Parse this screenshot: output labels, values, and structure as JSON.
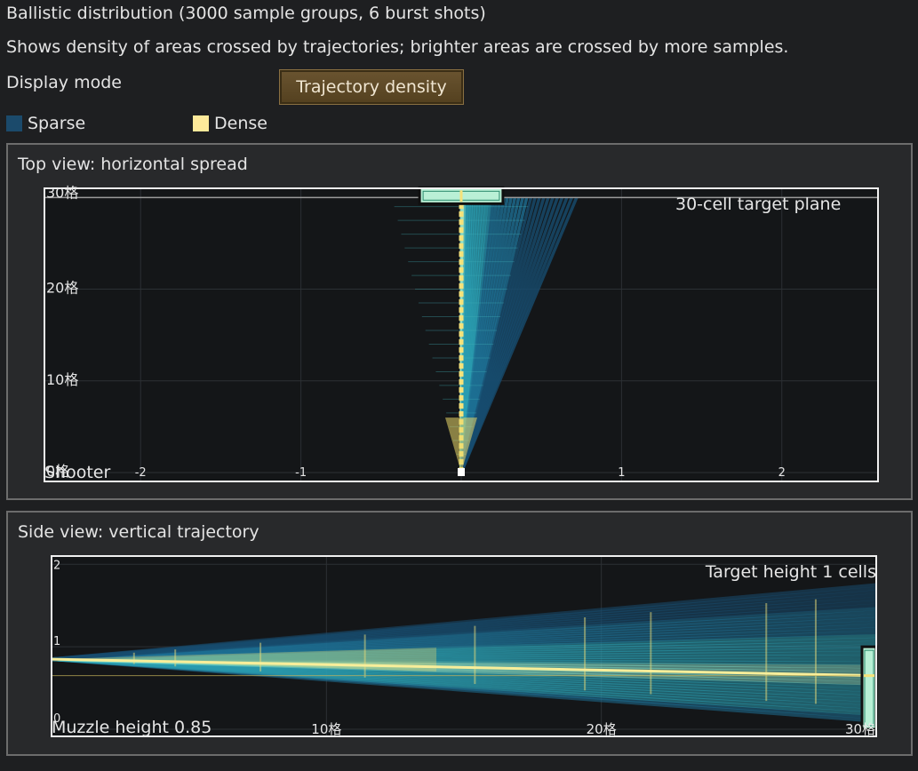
{
  "header": {
    "title": "Ballistic distribution (3000 sample groups, 6 burst shots)",
    "subtitle": "Shows density of areas crossed by trajectories; brighter areas are crossed by more samples.",
    "mode_label": "Display mode",
    "mode_button": "Trajectory density"
  },
  "legend": {
    "sparse_label": "Sparse",
    "dense_label": "Dense",
    "sparse_color": "#1b4a6b",
    "dense_color": "#fde99a"
  },
  "top_view": {
    "title": "Top view: horizontal spread",
    "shooter_label": "Shooter",
    "target_label": "30-cell target plane",
    "x_ticks": [
      "-2",
      "-1",
      "1",
      "2"
    ],
    "y_ticks": [
      "0格",
      "10格",
      "20格",
      "30格"
    ]
  },
  "side_view": {
    "title": "Side view: vertical trajectory",
    "muzzle_label": "Muzzle height 0.85",
    "target_label": "Target height 1 cells",
    "x_ticks": [
      "10格",
      "20格",
      "30格"
    ],
    "y_ticks": [
      "0",
      "1",
      "2"
    ]
  },
  "chart_data": [
    {
      "type": "heatmap",
      "title": "Top view: horizontal spread",
      "x_ticks": [
        -2,
        -1,
        1,
        2
      ],
      "y_ticks": [
        0,
        10,
        20,
        30
      ],
      "xlim": [
        -2.6,
        2.6
      ],
      "ylim": [
        0,
        31
      ],
      "spread_half_width_at_30": 0.72,
      "target": {
        "distance": 30,
        "x_range": [
          -0.26,
          0.26
        ]
      },
      "grid": true
    },
    {
      "type": "heatmap",
      "title": "Side view: vertical trajectory",
      "x_ticks": [
        10,
        20,
        30
      ],
      "y_ticks": [
        0,
        1,
        2
      ],
      "xlim": [
        0,
        30
      ],
      "ylim": [
        0,
        2.1
      ],
      "muzzle_height": 0.85,
      "target_height": 1,
      "spread_at_30": [
        0.1,
        1.75
      ],
      "mean_at_30": 0.65,
      "grid": true
    }
  ]
}
